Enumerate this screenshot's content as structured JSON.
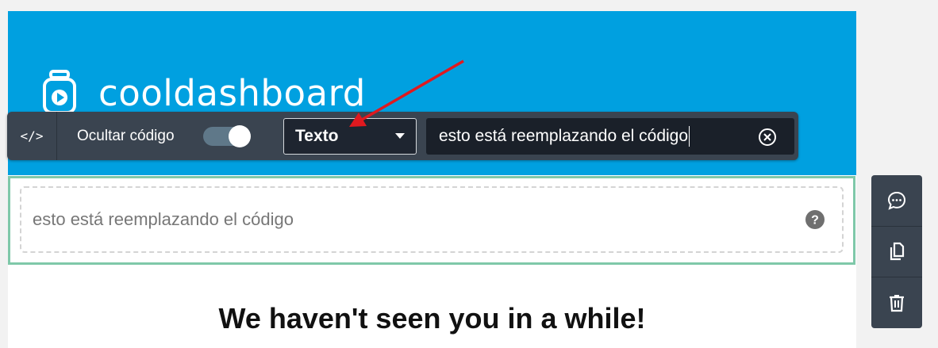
{
  "brand": {
    "name": "cooldashboard",
    "logo_icon": "camera-app-icon"
  },
  "toolbar": {
    "code_label": "</>",
    "hide_code_label": "Ocultar código",
    "hide_code_toggle_on": true,
    "type_select_value": "Texto",
    "text_input_value": "esto está reemplazando el código"
  },
  "block": {
    "placeholder_text": "esto está reemplazando el código"
  },
  "content": {
    "heading": "We haven't seen you in a while!"
  },
  "side_panel": {
    "buttons": [
      "comment-icon",
      "duplicate-icon",
      "delete-icon"
    ]
  },
  "colors": {
    "banner": "#00a0e0",
    "toolbar": "#3a4450",
    "selection_border": "#7fc8a9",
    "annotation_arrow": "#e0191f"
  }
}
